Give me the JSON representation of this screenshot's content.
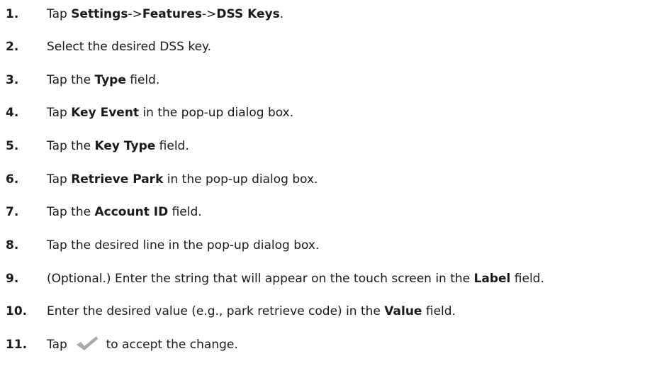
{
  "steps": [
    {
      "num": "1.",
      "parts": [
        {
          "t": "Tap "
        },
        {
          "t": "Settings",
          "b": true
        },
        {
          "t": "->"
        },
        {
          "t": "Features",
          "b": true
        },
        {
          "t": "->"
        },
        {
          "t": "DSS Keys",
          "b": true
        },
        {
          "t": "."
        }
      ]
    },
    {
      "num": "2.",
      "parts": [
        {
          "t": "Select the desired DSS key."
        }
      ]
    },
    {
      "num": "3.",
      "parts": [
        {
          "t": "Tap the "
        },
        {
          "t": "Type",
          "b": true
        },
        {
          "t": " field."
        }
      ]
    },
    {
      "num": "4.",
      "parts": [
        {
          "t": "Tap "
        },
        {
          "t": "Key Event",
          "b": true
        },
        {
          "t": " in the pop-up dialog box."
        }
      ]
    },
    {
      "num": "5.",
      "parts": [
        {
          "t": "Tap the "
        },
        {
          "t": "Key Type",
          "b": true
        },
        {
          "t": " field."
        }
      ]
    },
    {
      "num": "6.",
      "parts": [
        {
          "t": "Tap "
        },
        {
          "t": "Retrieve Park",
          "b": true
        },
        {
          "t": " in the pop-up dialog box."
        }
      ]
    },
    {
      "num": "7.",
      "parts": [
        {
          "t": "Tap the "
        },
        {
          "t": "Account ID",
          "b": true
        },
        {
          "t": " field."
        }
      ]
    },
    {
      "num": "8.",
      "parts": [
        {
          "t": "Tap the desired line in the pop-up dialog box."
        }
      ]
    },
    {
      "num": "9.",
      "parts": [
        {
          "t": "(Optional.) Enter the string that will appear on the touch screen in the "
        },
        {
          "t": "Label",
          "b": true
        },
        {
          "t": " field."
        }
      ]
    },
    {
      "num": "10.",
      "parts": [
        {
          "t": "Enter the desired value (e.g., park retrieve code) in the "
        },
        {
          "t": "Value",
          "b": true
        },
        {
          "t": " field."
        }
      ]
    },
    {
      "num": "11.",
      "parts": [
        {
          "t": "Tap "
        },
        {
          "icon": "checkmark-icon"
        },
        {
          "t": " to accept the change."
        }
      ]
    }
  ],
  "icon_colors": {
    "checkmark": "#a8a8a8"
  }
}
